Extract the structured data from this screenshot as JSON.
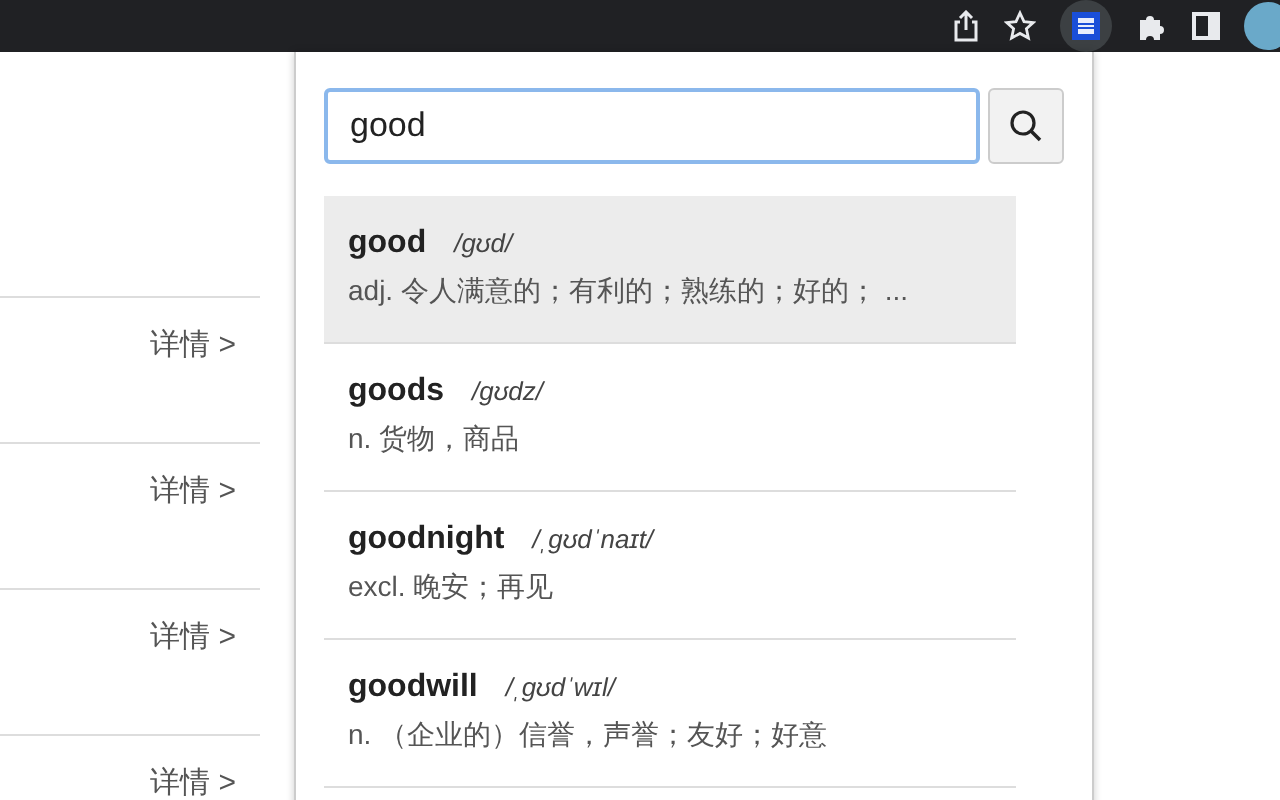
{
  "page": {
    "rows": [
      {
        "link": "详情 >"
      },
      {
        "link": "详情 >"
      },
      {
        "link": "详情 >"
      },
      {
        "link": "详情 >"
      }
    ]
  },
  "popup": {
    "search": {
      "value": "good"
    },
    "results": [
      {
        "word": "good",
        "phonetic": "/ɡʊd/",
        "definition": "adj. 令人满意的；有利的；熟练的；好的； ...",
        "selected": true
      },
      {
        "word": "goods",
        "phonetic": "/ɡʊdz/",
        "definition": "n. 货物，商品",
        "selected": false
      },
      {
        "word": "goodnight",
        "phonetic": "/ˌɡʊdˈnaɪt/",
        "definition": "excl. 晚安；再见",
        "selected": false
      },
      {
        "word": "goodwill",
        "phonetic": "/ˌɡʊdˈwɪl/",
        "definition": "n. （企业的）信誉，声誉；友好；好意",
        "selected": false
      }
    ]
  }
}
